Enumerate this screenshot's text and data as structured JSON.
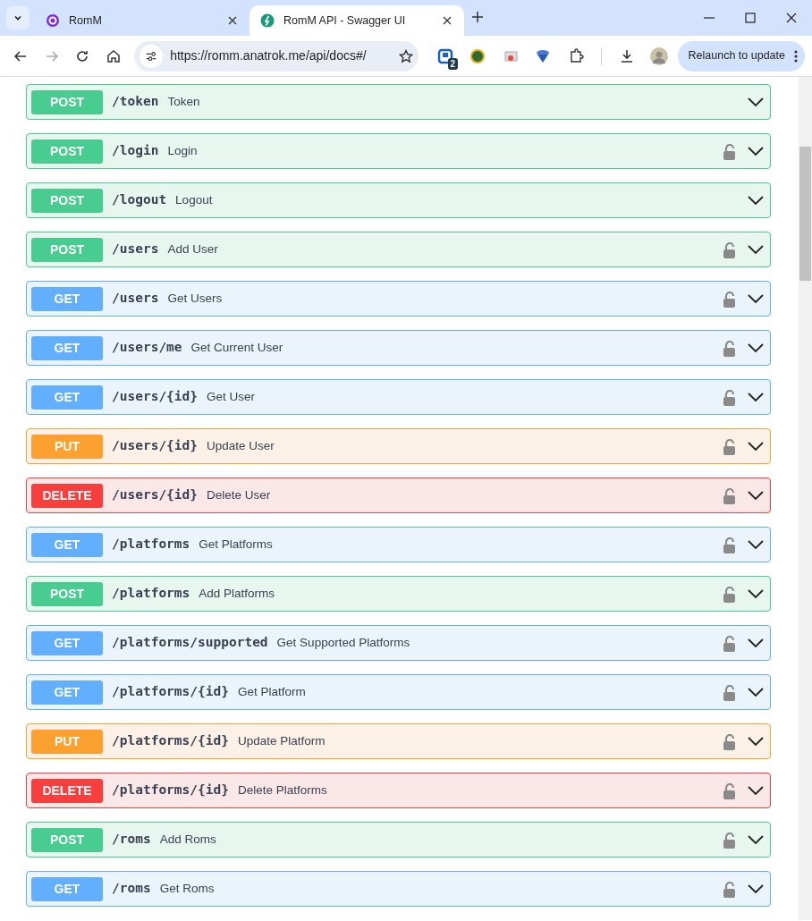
{
  "tabs": [
    {
      "title": "RomM",
      "selected": false,
      "kind": "romm"
    },
    {
      "title": "RomM API - Swagger UI",
      "selected": true,
      "kind": "swagger"
    }
  ],
  "toolbar": {
    "url": "https://romm.anatrok.me/api/docs#/",
    "extension_badge": "2",
    "relaunch_button": "Relaunch to update"
  },
  "endpoints": [
    {
      "method": "POST",
      "path": "/token",
      "summary": "Token",
      "locked": false
    },
    {
      "method": "POST",
      "path": "/login",
      "summary": "Login",
      "locked": true
    },
    {
      "method": "POST",
      "path": "/logout",
      "summary": "Logout",
      "locked": false
    },
    {
      "method": "POST",
      "path": "/users",
      "summary": "Add User",
      "locked": true
    },
    {
      "method": "GET",
      "path": "/users",
      "summary": "Get Users",
      "locked": true
    },
    {
      "method": "GET",
      "path": "/users/me",
      "summary": "Get Current User",
      "locked": true
    },
    {
      "method": "GET",
      "path": "/users/{id}",
      "summary": "Get User",
      "locked": true
    },
    {
      "method": "PUT",
      "path": "/users/{id}",
      "summary": "Update User",
      "locked": true
    },
    {
      "method": "DELETE",
      "path": "/users/{id}",
      "summary": "Delete User",
      "locked": true
    },
    {
      "method": "GET",
      "path": "/platforms",
      "summary": "Get Platforms",
      "locked": true
    },
    {
      "method": "POST",
      "path": "/platforms",
      "summary": "Add Platforms",
      "locked": true
    },
    {
      "method": "GET",
      "path": "/platforms/supported",
      "summary": "Get Supported Platforms",
      "locked": true
    },
    {
      "method": "GET",
      "path": "/platforms/{id}",
      "summary": "Get Platform",
      "locked": true
    },
    {
      "method": "PUT",
      "path": "/platforms/{id}",
      "summary": "Update Platform",
      "locked": true
    },
    {
      "method": "DELETE",
      "path": "/platforms/{id}",
      "summary": "Delete Platforms",
      "locked": true
    },
    {
      "method": "POST",
      "path": "/roms",
      "summary": "Add Roms",
      "locked": true
    },
    {
      "method": "GET",
      "path": "/roms",
      "summary": "Get Roms",
      "locked": true
    }
  ]
}
